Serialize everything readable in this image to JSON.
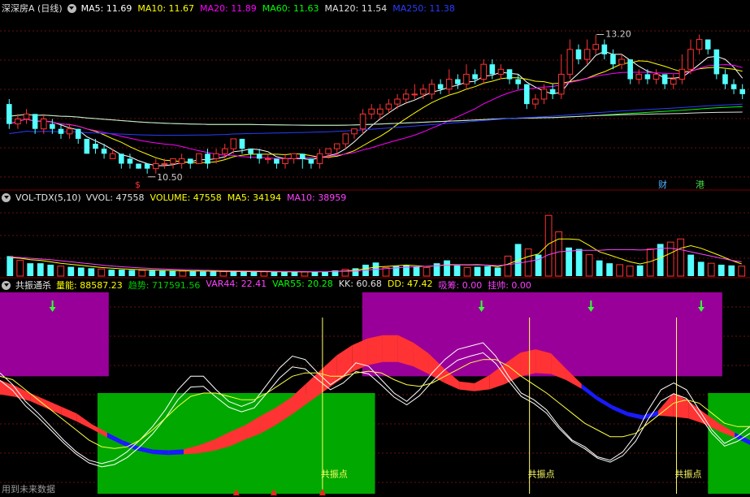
{
  "price_panel": {
    "title": "深深房A (日线)",
    "ma": [
      {
        "label": "MA5: 11.69",
        "color": "#ffffff"
      },
      {
        "label": "MA10: 11.67",
        "color": "#ffff00"
      },
      {
        "label": "MA20: 11.89",
        "color": "#ff00ff"
      },
      {
        "label": "MA60: 11.63",
        "color": "#00ff00"
      },
      {
        "label": "MA120: 11.54",
        "color": "#e0e0e0"
      },
      {
        "label": "MA250: 11.38",
        "color": "#2a3cff"
      }
    ],
    "high_label": "13.20",
    "low_label": "10.50",
    "marker_cai": "财",
    "marker_gang": "港",
    "marker_dollar": "$"
  },
  "volume_panel": {
    "title": "VOL-TDX(5,10)",
    "items": [
      {
        "label": "VVOL: 47558",
        "color": "#e0e0e0"
      },
      {
        "label": "VOLUME: 47558",
        "color": "#ffff00"
      },
      {
        "label": "MA5: 34194",
        "color": "#ffff00"
      },
      {
        "label": "MA10: 38959",
        "color": "#ff40ff"
      }
    ]
  },
  "indicator_panel": {
    "title": "共振通杀",
    "items": [
      {
        "label": "量能: 88587.23",
        "color": "#ffff00"
      },
      {
        "label": "趋势: 717591.56",
        "color": "#00cc00"
      },
      {
        "label": "VAR44: 22.41",
        "color": "#ff40ff"
      },
      {
        "label": "VAR55: 20.28",
        "color": "#00ff00"
      },
      {
        "label": "KK: 60.68",
        "color": "#e0e0e0"
      },
      {
        "label": "DD: 47.42",
        "color": "#ffff00"
      },
      {
        "label": "吸筹: 0.00",
        "color": "#ff40ff"
      },
      {
        "label": "挂帅: 0.00",
        "color": "#ff40ff"
      }
    ],
    "resonance_label": "共振点"
  },
  "footer": "用到未来数据",
  "chart_data": [
    {
      "type": "candlestick",
      "title": "深深房A (日线)",
      "ylim": [
        10.2,
        13.6
      ],
      "candles": [
        [
          11.8,
          11.4,
          11.9,
          11.3
        ],
        [
          11.4,
          11.5,
          11.6,
          11.3
        ],
        [
          11.5,
          11.6,
          11.7,
          11.4
        ],
        [
          11.6,
          11.3,
          11.6,
          11.2
        ],
        [
          11.3,
          11.5,
          11.6,
          11.2
        ],
        [
          11.4,
          11.3,
          11.5,
          11.2
        ],
        [
          11.3,
          11.2,
          11.4,
          11.1
        ],
        [
          11.2,
          11.3,
          11.4,
          11.1
        ],
        [
          11.3,
          11.1,
          11.3,
          11.0
        ],
        [
          11.1,
          10.8,
          11.1,
          10.8
        ],
        [
          11.0,
          10.9,
          11.1,
          10.8
        ],
        [
          10.9,
          10.8,
          11.0,
          10.7
        ],
        [
          10.7,
          10.8,
          10.9,
          10.7
        ],
        [
          10.8,
          10.6,
          10.8,
          10.5
        ],
        [
          10.7,
          10.6,
          10.8,
          10.5
        ],
        [
          10.6,
          10.5,
          10.6,
          10.5
        ],
        [
          10.6,
          10.5,
          10.6,
          10.4
        ],
        [
          10.5,
          10.6,
          10.7,
          10.4
        ],
        [
          10.6,
          10.6,
          10.7,
          10.5
        ],
        [
          10.6,
          10.7,
          10.7,
          10.5
        ],
        [
          10.6,
          10.7,
          10.8,
          10.5
        ],
        [
          10.7,
          10.6,
          10.7,
          10.5
        ],
        [
          10.6,
          10.8,
          10.8,
          10.6
        ],
        [
          10.8,
          10.6,
          10.9,
          10.5
        ],
        [
          10.7,
          10.8,
          10.9,
          10.6
        ],
        [
          10.8,
          10.9,
          11.0,
          10.7
        ],
        [
          10.9,
          11.1,
          11.1,
          10.8
        ],
        [
          11.1,
          10.9,
          11.1,
          10.8
        ],
        [
          10.9,
          10.8,
          10.9,
          10.7
        ],
        [
          10.8,
          10.7,
          10.9,
          10.6
        ],
        [
          10.7,
          10.7,
          10.8,
          10.6
        ],
        [
          10.7,
          10.6,
          10.7,
          10.5
        ],
        [
          10.6,
          10.7,
          10.8,
          10.5
        ],
        [
          10.7,
          10.8,
          10.8,
          10.6
        ],
        [
          10.8,
          10.7,
          10.8,
          10.5
        ],
        [
          10.7,
          10.6,
          10.7,
          10.5
        ],
        [
          10.6,
          10.8,
          10.9,
          10.5
        ],
        [
          10.8,
          10.9,
          10.9,
          10.7
        ],
        [
          10.9,
          11.0,
          11.0,
          10.8
        ],
        [
          11.0,
          11.2,
          11.2,
          10.9
        ],
        [
          11.2,
          11.3,
          11.3,
          11.1
        ],
        [
          11.3,
          11.6,
          11.7,
          11.2
        ],
        [
          11.6,
          11.7,
          11.8,
          11.5
        ],
        [
          11.6,
          11.7,
          11.8,
          11.5
        ],
        [
          11.7,
          11.8,
          11.9,
          11.6
        ],
        [
          11.8,
          11.9,
          12.0,
          11.7
        ],
        [
          11.9,
          12.0,
          12.1,
          11.8
        ],
        [
          12.0,
          12.0,
          12.2,
          11.9
        ],
        [
          12.0,
          12.1,
          12.2,
          11.9
        ],
        [
          12.0,
          12.2,
          12.3,
          11.9
        ],
        [
          12.2,
          12.1,
          12.3,
          12.0
        ],
        [
          12.1,
          12.3,
          12.5,
          12.0
        ],
        [
          12.3,
          12.2,
          12.4,
          12.1
        ],
        [
          12.2,
          12.4,
          12.6,
          12.1
        ],
        [
          12.4,
          12.3,
          12.5,
          12.2
        ],
        [
          12.3,
          12.6,
          12.7,
          12.2
        ],
        [
          12.6,
          12.4,
          12.7,
          12.3
        ],
        [
          12.4,
          12.5,
          12.6,
          12.3
        ],
        [
          12.5,
          12.3,
          12.5,
          12.2
        ],
        [
          12.3,
          12.2,
          12.4,
          12.1
        ],
        [
          12.2,
          11.8,
          12.2,
          11.7
        ],
        [
          11.8,
          11.9,
          12.0,
          11.7
        ],
        [
          11.9,
          12.1,
          12.2,
          11.8
        ],
        [
          12.1,
          12.0,
          12.2,
          11.9
        ],
        [
          12.0,
          12.4,
          12.8,
          11.9
        ],
        [
          12.4,
          12.9,
          13.1,
          12.3
        ],
        [
          12.9,
          12.7,
          13.0,
          12.6
        ],
        [
          12.7,
          12.9,
          13.1,
          12.6
        ],
        [
          12.9,
          13.0,
          13.2,
          12.8
        ],
        [
          13.0,
          12.8,
          13.1,
          12.7
        ],
        [
          12.8,
          12.6,
          12.9,
          12.5
        ],
        [
          12.6,
          12.7,
          12.8,
          12.5
        ],
        [
          12.7,
          12.3,
          12.7,
          12.2
        ],
        [
          12.3,
          12.4,
          12.5,
          12.2
        ],
        [
          12.4,
          12.3,
          12.5,
          12.2
        ],
        [
          12.3,
          12.4,
          12.5,
          12.2
        ],
        [
          12.4,
          12.2,
          12.4,
          12.1
        ],
        [
          12.2,
          12.3,
          12.4,
          12.1
        ],
        [
          12.3,
          12.5,
          12.8,
          12.2
        ],
        [
          12.5,
          12.9,
          13.1,
          12.4
        ],
        [
          12.9,
          13.1,
          13.2,
          12.8
        ],
        [
          13.1,
          12.9,
          13.1,
          12.8
        ],
        [
          12.9,
          12.4,
          12.9,
          12.3
        ],
        [
          12.4,
          12.2,
          12.5,
          12.1
        ],
        [
          12.2,
          12.1,
          12.3,
          12.0
        ],
        [
          12.1,
          12.0,
          12.2,
          11.9
        ]
      ],
      "ma_periods": [
        5,
        10,
        20,
        60,
        120,
        250
      ]
    },
    {
      "type": "bar",
      "title": "VOL-TDX(5,10)",
      "ylim": [
        0,
        100000
      ],
      "values": [
        28000,
        22000,
        18000,
        18000,
        16000,
        14000,
        13000,
        12000,
        11000,
        10000,
        9000,
        9000,
        8500,
        8000,
        7800,
        7500,
        7200,
        7000,
        6800,
        6600,
        6500,
        6400,
        6300,
        6200,
        6200,
        6100,
        6000,
        6000,
        6000,
        6000,
        6200,
        6500,
        8000,
        9500,
        11000,
        16000,
        19000,
        12000,
        14000,
        15000,
        13000,
        12000,
        18000,
        22000,
        15000,
        12000,
        13000,
        14000,
        12000,
        28000,
        45000,
        38000,
        30000,
        85000,
        62000,
        40000,
        38000,
        30000,
        22000,
        18000,
        16000,
        14000,
        15000,
        38000,
        45000,
        47558,
        52000,
        30000,
        20000,
        18000,
        16000,
        15000,
        14000
      ],
      "ma5": [
        26000,
        25000,
        23000,
        22000,
        20000,
        18000,
        16500,
        15000,
        13500,
        12000,
        11000,
        10200,
        9600,
        9000,
        8500,
        8100,
        7800,
        7500,
        7200,
        7000,
        6800,
        6600,
        6500,
        6400,
        6300,
        6200,
        6100,
        6050,
        6000,
        6000,
        6050,
        6150,
        6600,
        7300,
        8200,
        10300,
        12700,
        13500,
        14500,
        15500,
        14500,
        13500,
        14400,
        16000,
        16000,
        15800,
        16000,
        15200,
        13200,
        16800,
        22400,
        27400,
        31000,
        45000,
        52000,
        52000,
        51000,
        43000,
        34000,
        29600,
        24800,
        20000,
        17000,
        20200,
        25600,
        32000,
        39000,
        42600,
        39000,
        33500,
        28000,
        22000,
        17000
      ],
      "ma10": [
        27000,
        26000,
        25000,
        24000,
        23000,
        21500,
        20000,
        18500,
        17000,
        15500,
        14200,
        13100,
        12200,
        11400,
        10700,
        10100,
        9600,
        9100,
        8700,
        8300,
        8000,
        7700,
        7500,
        7300,
        7100,
        6900,
        6750,
        6600,
        6500,
        6400,
        6300,
        6300,
        6500,
        6800,
        7200,
        8200,
        9600,
        10400,
        11500,
        12500,
        13200,
        13800,
        14600,
        15400,
        15600,
        15500,
        15500,
        15500,
        14800,
        16000,
        18000,
        20500,
        23000,
        30000,
        34000,
        35000,
        36000,
        36000,
        36000,
        37000,
        37000,
        37000,
        36500,
        37000,
        38959,
        38959,
        37000,
        34000,
        31000,
        28000,
        25000,
        22000,
        20000
      ],
      "yvol_color": "#55ffff"
    },
    {
      "type": "area",
      "title": "共振通杀",
      "ylim": [
        -10,
        110
      ],
      "upper_zone": [
        80,
        100
      ],
      "lower_zone": [
        0,
        50
      ],
      "purple_boxes": [
        [
          0,
          0.145
        ],
        [
          0.483,
          0.963
        ]
      ],
      "green_boxes": [
        [
          0.13,
          0.5
        ],
        [
          0.944,
          1.0
        ]
      ],
      "kk": [
        62,
        55,
        45,
        38,
        30,
        22,
        15,
        10,
        8,
        10,
        15,
        22,
        30,
        40,
        52,
        60,
        60,
        52,
        45,
        42,
        45,
        55,
        65,
        72,
        70,
        62,
        55,
        60,
        68,
        66,
        58,
        50,
        45,
        52,
        62,
        70,
        76,
        78,
        80,
        72,
        60,
        50,
        46,
        40,
        30,
        22,
        18,
        12,
        10,
        15,
        25,
        40,
        52,
        56,
        52,
        40,
        28,
        20,
        24,
        30
      ],
      "dd": [
        60,
        58,
        52,
        46,
        40,
        34,
        28,
        22,
        18,
        17,
        18,
        22,
        28,
        35,
        42,
        48,
        50,
        50,
        48,
        46,
        46,
        50,
        55,
        60,
        62,
        62,
        60,
        60,
        62,
        63,
        62,
        58,
        55,
        54,
        56,
        60,
        64,
        68,
        70,
        70,
        66,
        60,
        55,
        50,
        44,
        38,
        32,
        28,
        24,
        24,
        26,
        32,
        38,
        44,
        46,
        44,
        38,
        32,
        30,
        30
      ],
      "var44": [
        55,
        52,
        48,
        44,
        40,
        36,
        30,
        25,
        20,
        16,
        14,
        14,
        15,
        17,
        20,
        24,
        28,
        33,
        38,
        44,
        52,
        60,
        68,
        74,
        78,
        80,
        80,
        76,
        70,
        62,
        55,
        54,
        58,
        64,
        70,
        72,
        70,
        62,
        54,
        46,
        40,
        36,
        34,
        38,
        46,
        42,
        36,
        30,
        25,
        20
      ],
      "var55": [
        52,
        50,
        47,
        43,
        39,
        35,
        30,
        25,
        21,
        18,
        16,
        15,
        15,
        16,
        18,
        21,
        25,
        29,
        34,
        40,
        47,
        54,
        61,
        67,
        71,
        73,
        73,
        70,
        65,
        59,
        54,
        53,
        55,
        59,
        64,
        66,
        65,
        60,
        54,
        48,
        43,
        39,
        37,
        38,
        40,
        38,
        34,
        29,
        25,
        21
      ],
      "resonance_x": [
        0.43,
        0.706,
        0.902
      ],
      "arrows_down_x": [
        0.07,
        0.642,
        0.788,
        0.935
      ],
      "arrows_up_x": [
        0.315,
        0.365,
        0.43
      ]
    }
  ]
}
